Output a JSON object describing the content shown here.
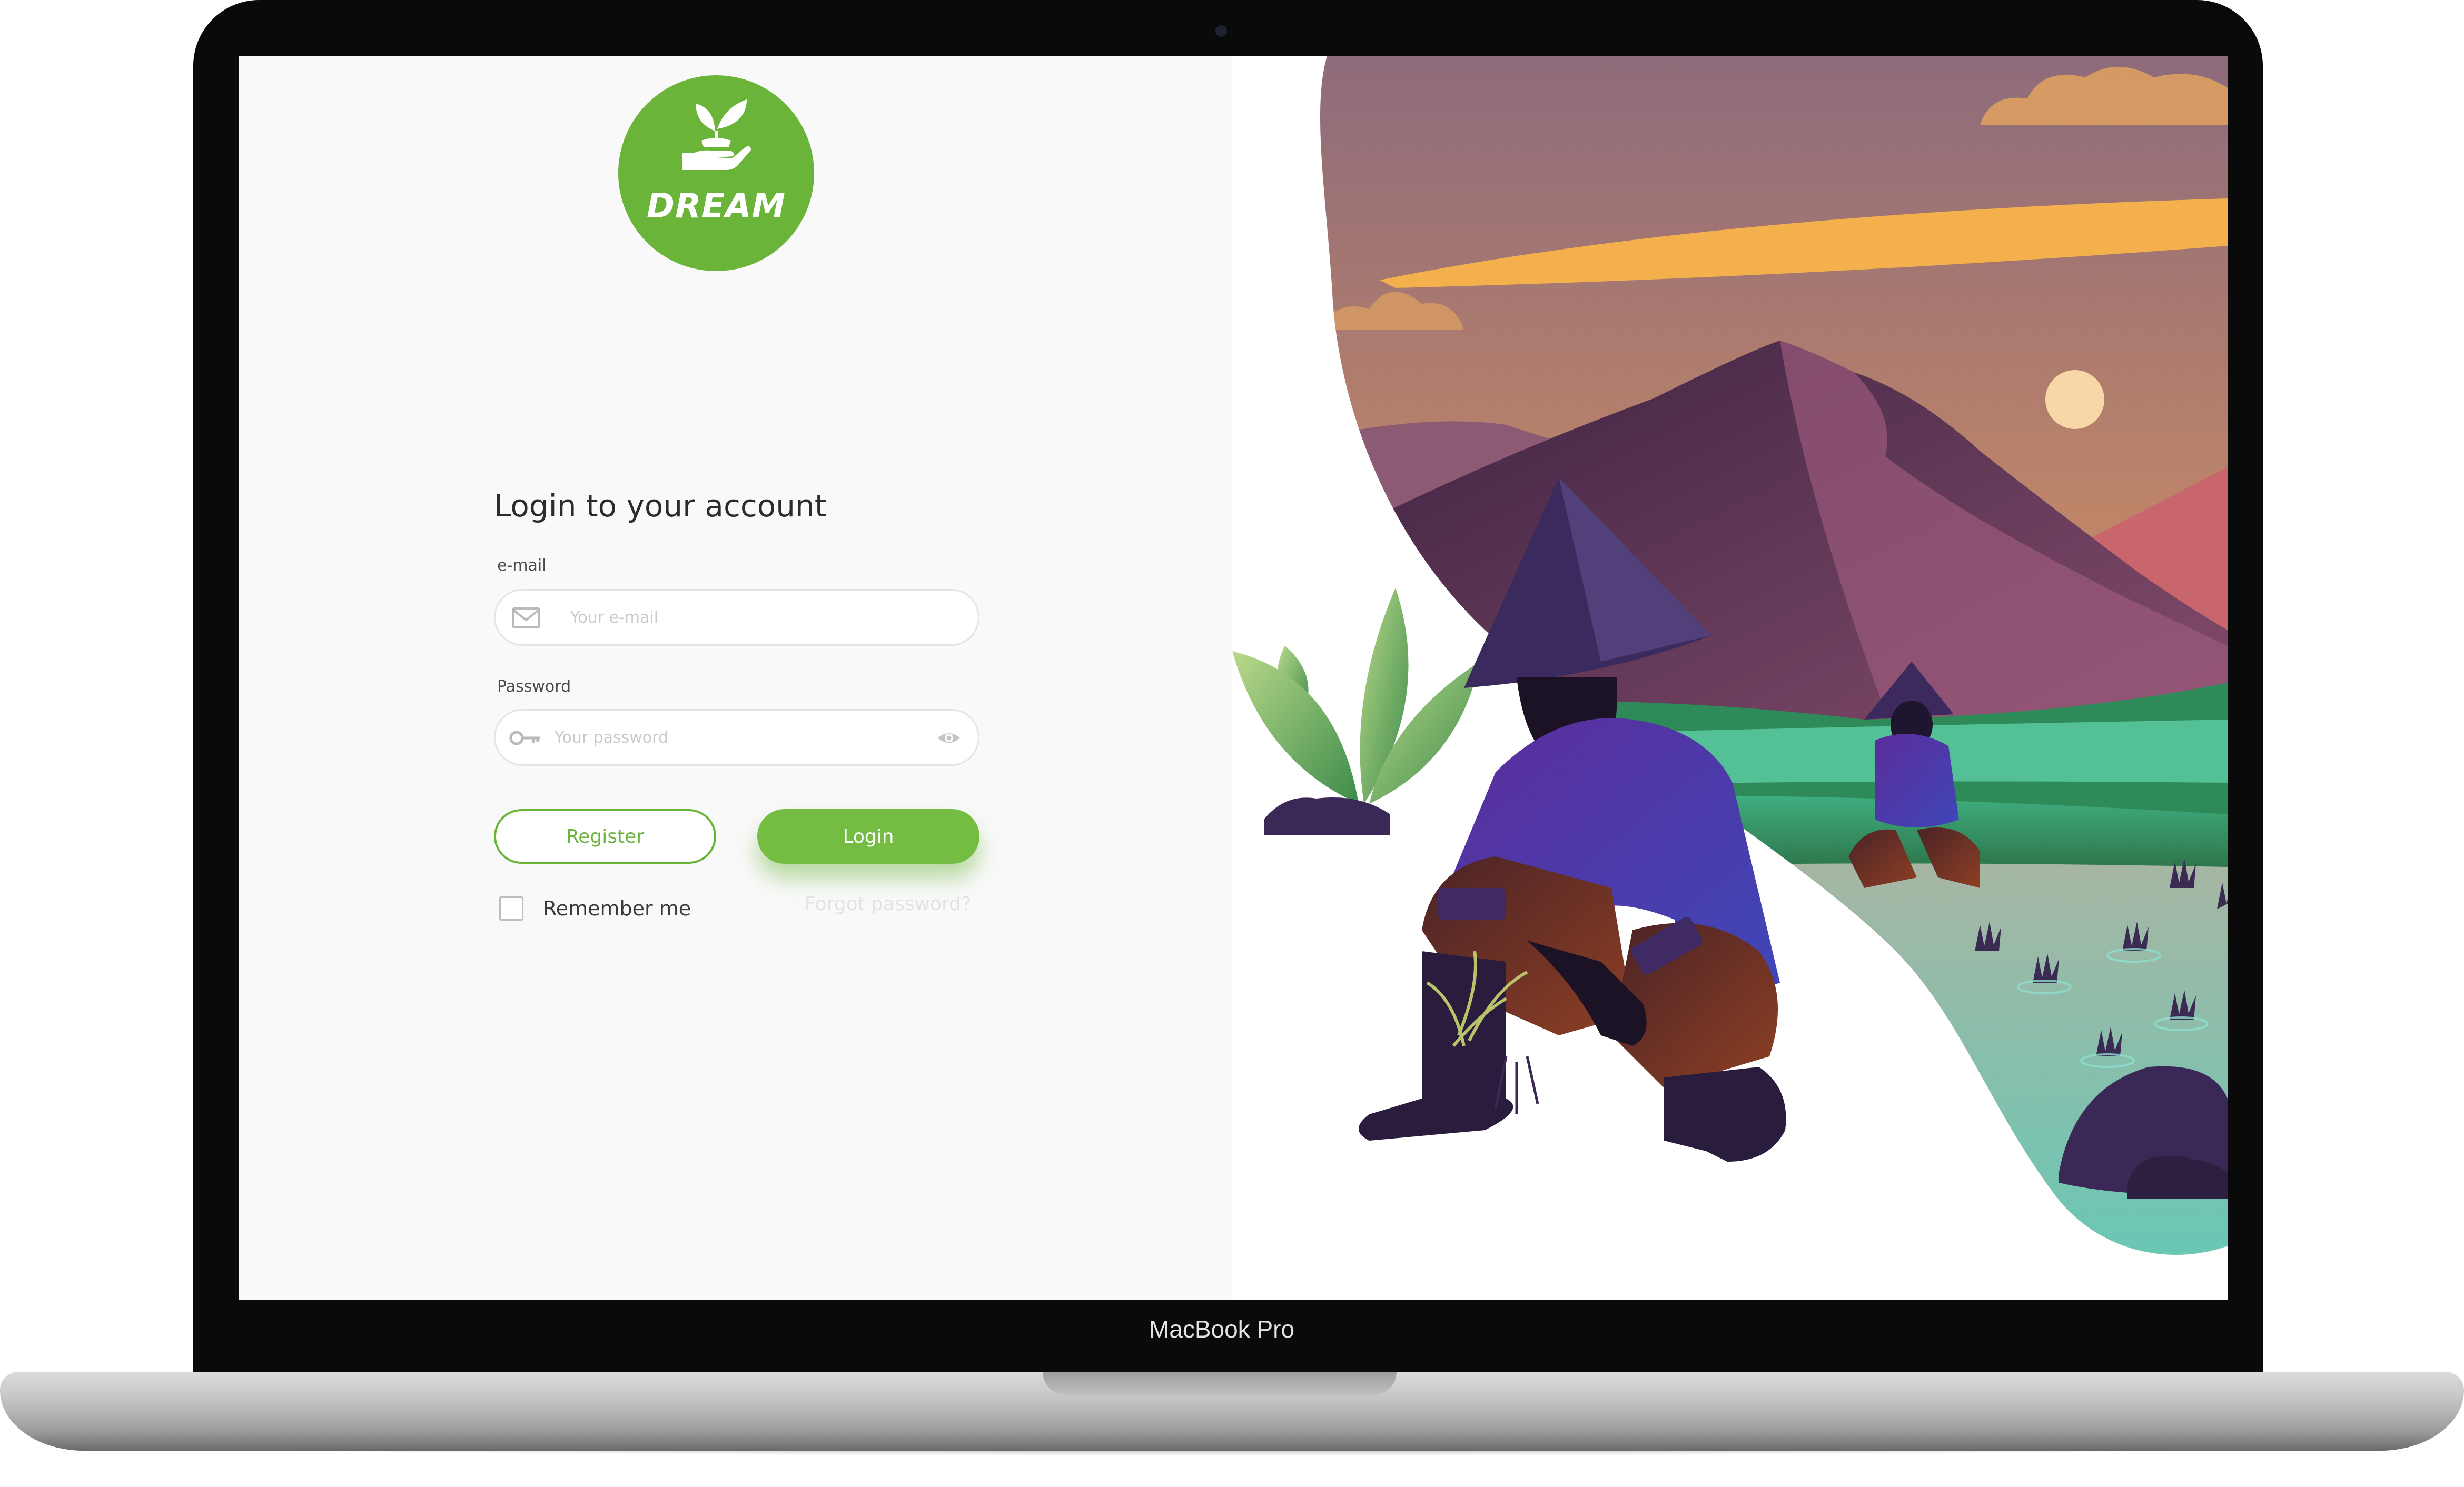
{
  "device": {
    "model_label": "MacBook Pro"
  },
  "brand": {
    "name": "DREAM",
    "logo_icon": "sprout-in-hand-icon",
    "accent_color": "#6ab43a"
  },
  "login_form": {
    "title": "Login to your account",
    "email": {
      "label": "e-mail",
      "placeholder": "Your e-mail",
      "value": "",
      "icon": "envelope-icon"
    },
    "password": {
      "label": "Password",
      "placeholder": "Your password",
      "value": "",
      "icon": "key-icon",
      "toggle_icon": "eye-icon"
    },
    "register_label": "Register",
    "login_label": "Login",
    "remember_label": "Remember me",
    "remember_checked": false,
    "forgot_label": "Forgot password?"
  },
  "illustration": {
    "subject": "rice-farmers-illustration",
    "colors": {
      "sky_top": "#8e6b7b",
      "sky_bottom": "#f0a24e",
      "mountain": "#4a2a4d",
      "field": "#4f9c4e",
      "water": "#6cc5b4",
      "shirt": "#4a2d92",
      "sun": "#f6d7a5"
    }
  }
}
